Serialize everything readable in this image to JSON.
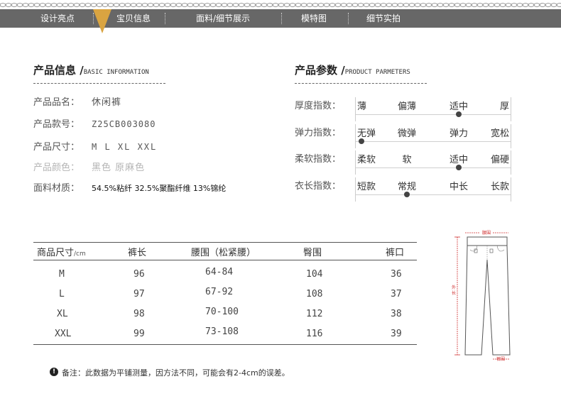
{
  "nav": {
    "items": [
      "设计亮点",
      "宝贝信息",
      "面料/细节展示",
      "模特图",
      "细节实拍"
    ]
  },
  "product_info": {
    "title": "产品信息 /",
    "title_en": "BASIC INFORMATION",
    "rows": [
      {
        "label": "产品品名：",
        "value": "休闲裤"
      },
      {
        "label": "产品款号：",
        "value": "Z25CB003080"
      },
      {
        "label": "产品尺寸：",
        "value": "M L XL XXL"
      },
      {
        "label": "产品颜色：",
        "value": "黑色 原麻色"
      },
      {
        "label": "面料材质：",
        "value": "54.5%粘纤 32.5%聚酯纤维 13%锦纶"
      }
    ]
  },
  "product_params": {
    "title": "产品参数 /",
    "title_en": "PRODUCT PARMETERS",
    "rows": [
      {
        "label": "厚度指数：",
        "options": [
          "薄",
          "偏薄",
          "适中",
          "厚"
        ],
        "selected": 2
      },
      {
        "label": "弹力指数：",
        "options": [
          "无弹",
          "微弹",
          "弹力",
          "宽松"
        ],
        "selected": 0
      },
      {
        "label": "柔软指数：",
        "options": [
          "柔软",
          "软",
          "适中",
          "偏硬"
        ],
        "selected": 2
      },
      {
        "label": "衣长指数：",
        "options": [
          "短款",
          "常规",
          "中长",
          "长款"
        ],
        "selected": 1
      }
    ]
  },
  "size_table": {
    "header_main": "商品尺寸",
    "header_unit": "/cm",
    "columns": [
      "裤长",
      "腰围（松紧腰）",
      "臀围",
      "裤口"
    ],
    "rows": [
      [
        "M",
        "96",
        "64-84",
        "104",
        "36"
      ],
      [
        "L",
        "97",
        "67-92",
        "108",
        "37"
      ],
      [
        "XL",
        "98",
        "70-100",
        "112",
        "38"
      ],
      [
        "XXL",
        "99",
        "73-108",
        "116",
        "39"
      ]
    ]
  },
  "note": {
    "icon": "!",
    "text": "备注：此数据为平铺测量，因方法不同，可能会有2-4cm的误差。"
  },
  "diagram": {
    "labels": [
      "腰围",
      "外长",
      "裤围"
    ]
  },
  "colors": {
    "nav_bg": "#676767",
    "accent": "#d9a441",
    "measure": "#d03030"
  }
}
